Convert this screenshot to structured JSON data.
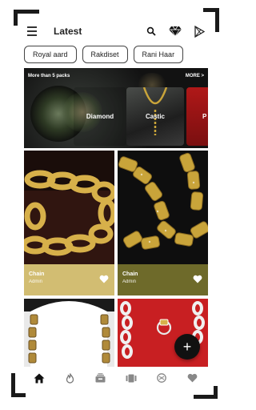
{
  "app": {
    "title": "Latest"
  },
  "chips": [
    "Royal aard",
    "Rakdiset",
    "Rani Haar"
  ],
  "banner": {
    "header_left": "More than 5 packs",
    "header_right": "MORE >",
    "cards": [
      {
        "label": "Diamond"
      },
      {
        "label": "Castic"
      },
      {
        "label": "P"
      }
    ]
  },
  "grid": [
    {
      "name": "Chain",
      "author": "Admin",
      "footer_color": "#d2bd72"
    },
    {
      "name": "Chain",
      "author": "Admin",
      "footer_color": "#6e6a2a"
    },
    {
      "name": "",
      "author": ""
    },
    {
      "name": "",
      "author": ""
    }
  ],
  "fab": {
    "label": "+"
  },
  "colors": {
    "gold": "#c9a43a",
    "dark": "#111111",
    "red": "#c81f22"
  }
}
